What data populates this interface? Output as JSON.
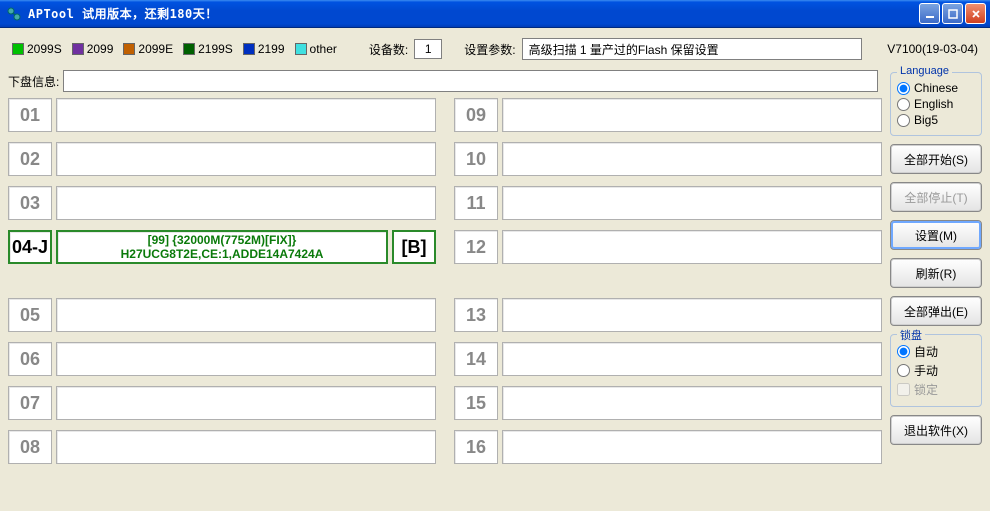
{
  "window": {
    "title": "APTool  试用版本，还剩180天！"
  },
  "legend": [
    {
      "label": "2099S",
      "color": "#00c000"
    },
    {
      "label": "2099",
      "color": "#7030a0"
    },
    {
      "label": "2099E",
      "color": "#c06000"
    },
    {
      "label": "2199S",
      "color": "#006000"
    },
    {
      "label": "2199",
      "color": "#0030c0"
    },
    {
      "label": "other",
      "color": "#40e0e0"
    }
  ],
  "toolbar": {
    "device_label": "设备数:",
    "device_count": "1",
    "param_label": "设置参数:",
    "param_value": "高级扫描 1 量产过的Flash 保留设置",
    "version": "V7100(19-03-04)"
  },
  "info": {
    "label": "下盘信息:",
    "value": ""
  },
  "slots_left": [
    {
      "num": "01",
      "active": false
    },
    {
      "num": "02",
      "active": false
    },
    {
      "num": "03",
      "active": false
    },
    {
      "num": "04-J",
      "active": true,
      "line1": "[99] {32000M(7752M)[FIX]}",
      "line2": "H27UCG8T2E,CE:1,ADDE14A7424A",
      "suffix": "[B]"
    },
    {
      "spacer": true
    },
    {
      "num": "05",
      "active": false
    },
    {
      "num": "06",
      "active": false
    },
    {
      "num": "07",
      "active": false
    },
    {
      "num": "08",
      "active": false
    }
  ],
  "slots_right": [
    {
      "num": "09",
      "active": false
    },
    {
      "num": "10",
      "active": false
    },
    {
      "num": "11",
      "active": false
    },
    {
      "num": "12",
      "active": false
    },
    {
      "spacer": true
    },
    {
      "num": "13",
      "active": false
    },
    {
      "num": "14",
      "active": false
    },
    {
      "num": "15",
      "active": false
    },
    {
      "num": "16",
      "active": false
    }
  ],
  "language": {
    "title": "Language",
    "options": [
      "Chinese",
      "English",
      "Big5"
    ],
    "selected": "Chinese"
  },
  "lockdisk": {
    "title": "锁盘",
    "auto": "自动",
    "manual": "手动",
    "lock": "锁定",
    "selected": "自动",
    "lock_checked": false
  },
  "buttons": {
    "start_all": "全部开始(S)",
    "stop_all": "全部停止(T)",
    "settings": "设置(M)",
    "refresh": "刷新(R)",
    "eject_all": "全部弹出(E)",
    "exit": "退出软件(X)"
  }
}
